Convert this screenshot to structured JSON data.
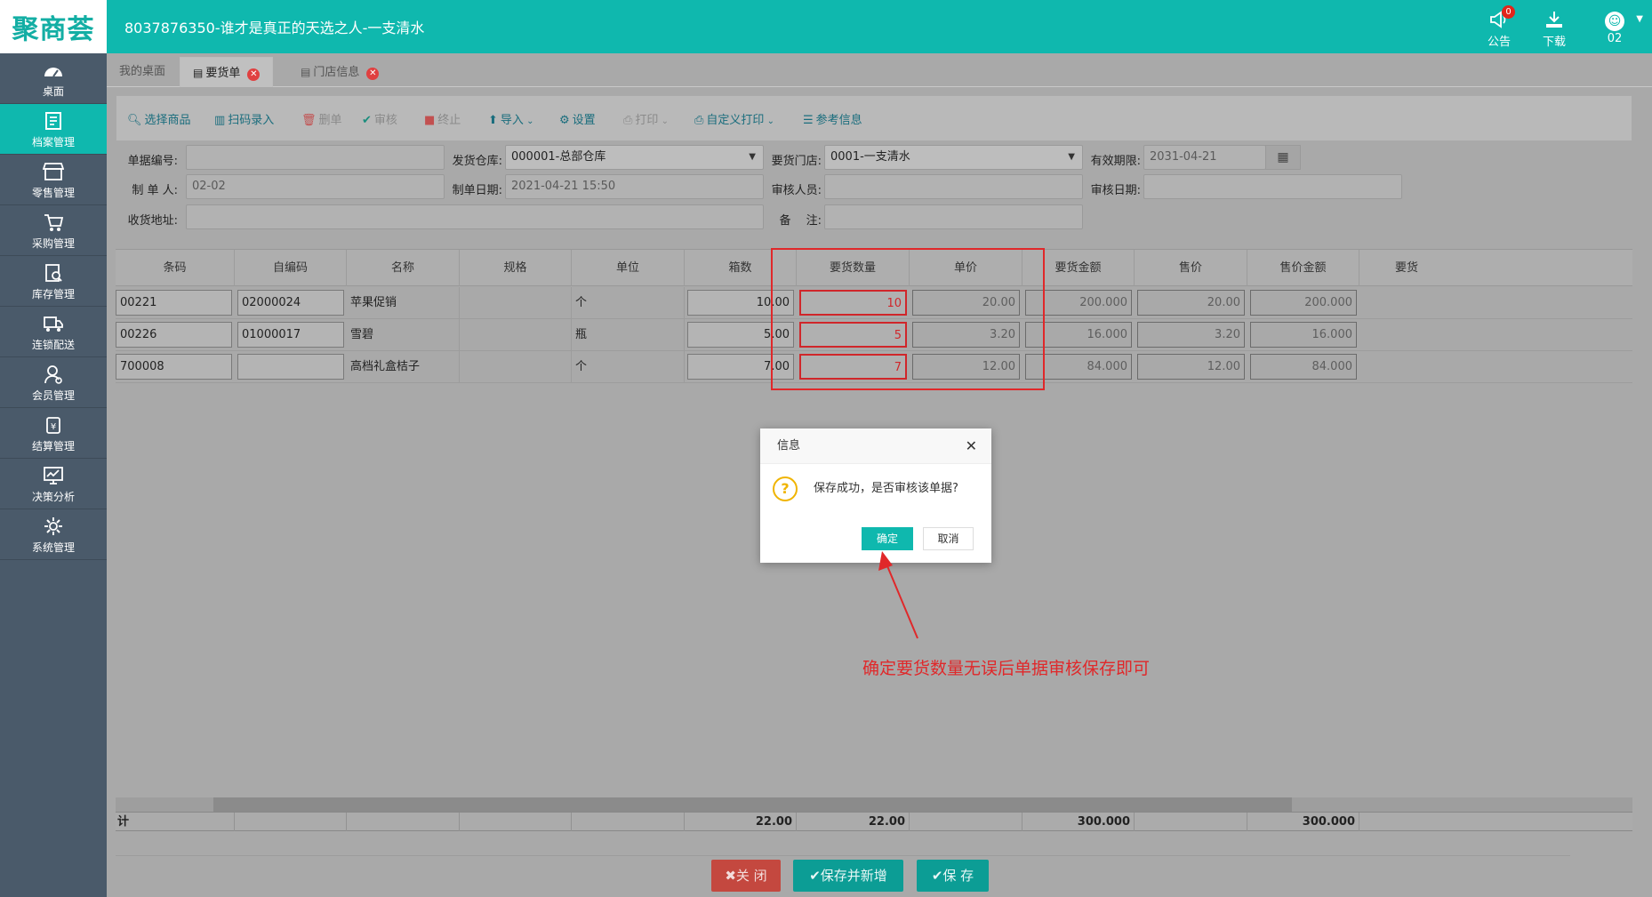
{
  "header": {
    "logo": "聚商荟",
    "title": "8037876350-谁才是真正的天选之人-一支清水",
    "announce_label": "公告",
    "announce_badge": "0",
    "download_label": "下载",
    "user_label": "02"
  },
  "sidebar": {
    "items": [
      {
        "label": "桌面",
        "icon": "dashboard-icon"
      },
      {
        "label": "档案管理",
        "icon": "archive-icon"
      },
      {
        "label": "零售管理",
        "icon": "store-icon"
      },
      {
        "label": "采购管理",
        "icon": "cart-icon"
      },
      {
        "label": "库存管理",
        "icon": "inventory-icon"
      },
      {
        "label": "连锁配送",
        "icon": "truck-icon"
      },
      {
        "label": "会员管理",
        "icon": "member-icon"
      },
      {
        "label": "结算管理",
        "icon": "settlement-icon"
      },
      {
        "label": "决策分析",
        "icon": "chart-icon"
      },
      {
        "label": "系统管理",
        "icon": "gear-icon"
      }
    ],
    "active_index": 1
  },
  "tabs": [
    {
      "label": "我的桌面"
    },
    {
      "label": "要货单"
    },
    {
      "label": "门店信息"
    }
  ],
  "toolbar": {
    "select_goods": "选择商品",
    "scan_entry": "扫码录入",
    "delete": "删单",
    "audit": "审核",
    "terminate": "终止",
    "import": "导入",
    "settings": "设置",
    "print": "打印",
    "custom_print": "自定义打印",
    "reference": "参考信息"
  },
  "form": {
    "doc_no_label": "单据编号:",
    "doc_no_value": "",
    "warehouse_label": "发货仓库:",
    "warehouse_value": "000001-总部仓库",
    "store_label": "要货门店:",
    "store_value": "0001-一支清水",
    "valid_label": "有效期限:",
    "valid_value": "2031-04-21",
    "maker_label": "制 单 人:",
    "maker_value": "02-02",
    "make_date_label": "制单日期:",
    "make_date_value": "2021-04-21 15:50",
    "auditor_label": "审核人员:",
    "auditor_value": "",
    "audit_date_label": "审核日期:",
    "audit_date_value": "",
    "address_label": "收货地址:",
    "address_value": "",
    "remark_label": "备　 注:",
    "remark_value": ""
  },
  "table": {
    "columns": [
      "条码",
      "自编码",
      "名称",
      "规格",
      "单位",
      "箱数",
      "要货数量",
      "单价",
      "要货金额",
      "售价",
      "售价金额",
      "要货"
    ],
    "rows": [
      {
        "barcode": "00221",
        "code": "02000024",
        "name": "苹果促销",
        "spec": "",
        "unit": "个",
        "boxes": "10.00",
        "qty": "10",
        "price": "20.00",
        "amount": "200.000",
        "sale_price": "20.00",
        "sale_amount": "200.000"
      },
      {
        "barcode": "00226",
        "code": "01000017",
        "name": "雪碧",
        "spec": "",
        "unit": "瓶",
        "boxes": "5.00",
        "qty": "5",
        "price": "3.20",
        "amount": "16.000",
        "sale_price": "3.20",
        "sale_amount": "16.000"
      },
      {
        "barcode": "700008",
        "code": "",
        "name": "高档礼盒桔子",
        "spec": "",
        "unit": "个",
        "boxes": "7.00",
        "qty": "7",
        "price": "12.00",
        "amount": "84.000",
        "sale_price": "12.00",
        "sale_amount": "84.000"
      }
    ],
    "totals": {
      "label": "计",
      "boxes": "22.00",
      "qty": "22.00",
      "amount": "300.000",
      "sale_amount": "300.000"
    }
  },
  "footer": {
    "close": "关 闭",
    "save_new": "保存并新增",
    "save": "保 存"
  },
  "dialog": {
    "title": "信息",
    "message": "保存成功，是否审核该单据?",
    "ok": "确定",
    "cancel": "取消"
  },
  "annotation": "确定要货数量无误后单据审核保存即可"
}
